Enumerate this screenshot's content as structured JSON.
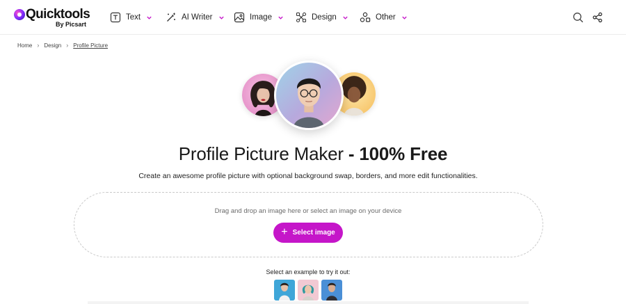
{
  "brand": {
    "name": "Quicktools",
    "byline": "By Picsart",
    "accent": "#c516c9"
  },
  "nav": {
    "items": [
      {
        "label": "Text",
        "icon": "text-box-icon"
      },
      {
        "label": "AI Writer",
        "icon": "magic-wand-icon"
      },
      {
        "label": "Image",
        "icon": "image-icon"
      },
      {
        "label": "Design",
        "icon": "design-tools-icon"
      },
      {
        "label": "Other",
        "icon": "shapes-icon"
      }
    ]
  },
  "header_actions": {
    "search_icon": "search-icon",
    "share_icon": "share-icon"
  },
  "breadcrumb": {
    "items": [
      "Home",
      "Design",
      "Profile Picture"
    ]
  },
  "hero": {
    "title_main": "Profile Picture Maker ",
    "title_bold": "- 100% Free",
    "subtitle": "Create an awesome profile picture with optional background swap, borders, and more edit functionalities."
  },
  "upload": {
    "drop_text": "Drag and drop an image here or select an image on your device",
    "button_label": "Select image"
  },
  "examples": {
    "label": "Select an example to try it out:"
  }
}
